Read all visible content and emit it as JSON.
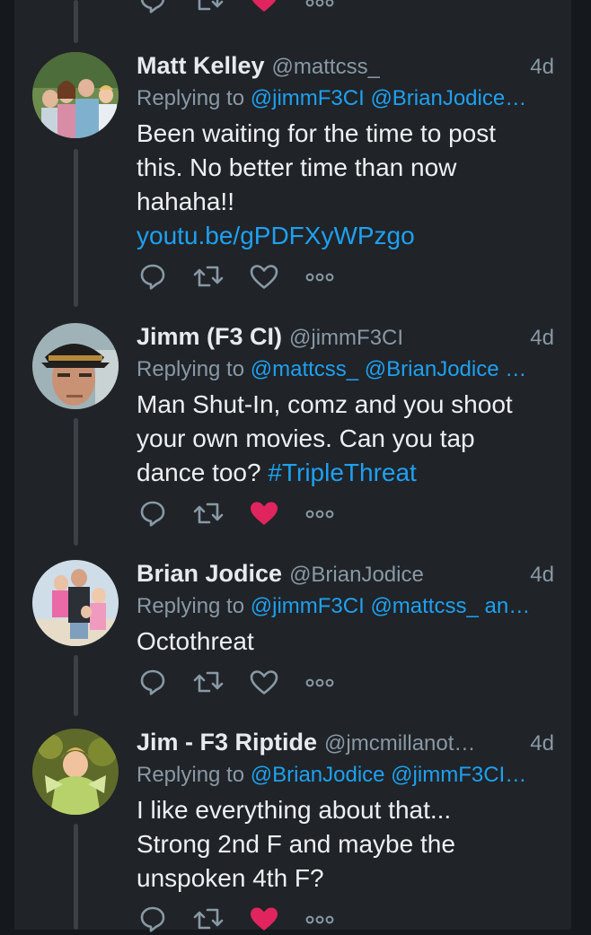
{
  "colors": {
    "background": "#15181c",
    "panel": "#202327",
    "text": "#e6ebef",
    "muted": "#8899a6",
    "link": "#1da1f2",
    "like": "#e0245e"
  },
  "tweets": [
    {
      "name": "Matt Kelley",
      "handle": "@mattcss_",
      "time": "4d",
      "replying_prefix": "Replying to",
      "replying_to": "@jimmF3CI @BrianJodice…",
      "body_lines": [
        "Been waiting for the time to post",
        "this. No better time than now",
        "hahaha!!"
      ],
      "link": "youtu.be/gPDFXyWPzgo",
      "liked": false
    },
    {
      "name": "Jimm (F3 CI)",
      "handle": "@jimmF3CI",
      "time": "4d",
      "replying_prefix": "Replying to",
      "replying_to": "@mattcss_ @BrianJodice …",
      "body_lines": [
        "Man Shut-In, comz and you shoot",
        "your own movies. Can you tap"
      ],
      "body_last_text": "dance too?",
      "hashtag": "#TripleThreat",
      "liked": true
    },
    {
      "name": "Brian Jodice",
      "handle": "@BrianJodice",
      "time": "4d",
      "replying_prefix": "Replying to",
      "replying_to": "@jimmF3CI @mattcss_ an…",
      "body_lines": [
        "Octothreat"
      ],
      "liked": false
    },
    {
      "name": "Jim - F3 Riptide",
      "handle": "@jmcmillanot…",
      "time": "4d",
      "replying_prefix": "Replying to",
      "replying_to": "@BrianJodice @jimmF3CI…",
      "body_lines": [
        "I like everything about that...",
        "Strong 2nd F and maybe the",
        "unspoken 4th F?"
      ],
      "liked": true
    }
  ],
  "icons": {
    "reply": "reply-icon",
    "retweet": "retweet-icon",
    "like": "heart-icon",
    "more": "more-icon"
  }
}
